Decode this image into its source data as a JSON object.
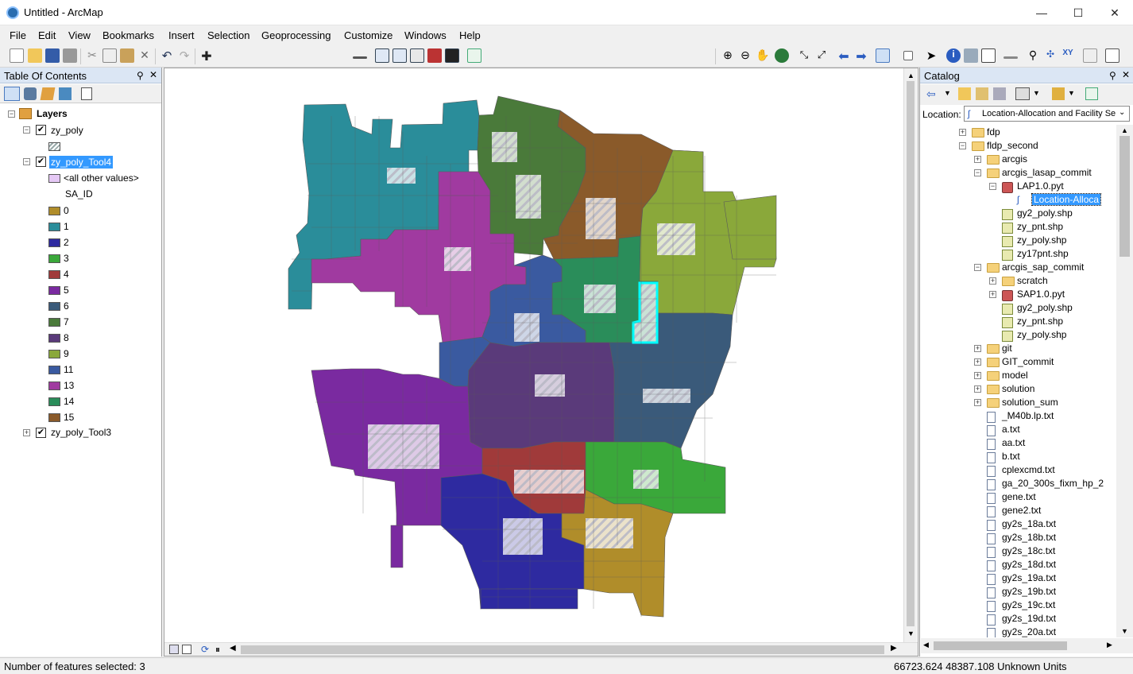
{
  "window": {
    "title": "Untitled - ArcMap",
    "min": "—",
    "max": "☐",
    "close": "✕"
  },
  "menu": [
    "File",
    "Edit",
    "View",
    "Bookmarks",
    "Insert",
    "Selection",
    "Geoprocessing",
    "Customize",
    "Windows",
    "Help"
  ],
  "toc": {
    "title": "Table Of Contents",
    "root": "Layers",
    "layer1": "zy_poly",
    "layer2": "zy_poly_Tool4",
    "other_values": "<all other values>",
    "field": "SA_ID",
    "classes": [
      {
        "label": "0",
        "color": "#b08d2a"
      },
      {
        "label": "1",
        "color": "#2a8d9a"
      },
      {
        "label": "2",
        "color": "#2e2aa0"
      },
      {
        "label": "3",
        "color": "#3aa83a"
      },
      {
        "label": "4",
        "color": "#a03a3a"
      },
      {
        "label": "5",
        "color": "#7a2aa0"
      },
      {
        "label": "6",
        "color": "#3a5a7a"
      },
      {
        "label": "7",
        "color": "#4a7a3a"
      },
      {
        "label": "8",
        "color": "#5a3a7a"
      },
      {
        "label": "9",
        "color": "#8aa83a"
      },
      {
        "label": "11",
        "color": "#3a5aa0"
      },
      {
        "label": "13",
        "color": "#a03aa0"
      },
      {
        "label": "14",
        "color": "#2a8d5a"
      },
      {
        "label": "15",
        "color": "#8a5a2a"
      }
    ],
    "layer3": "zy_poly_Tool3"
  },
  "catalog": {
    "title": "Catalog",
    "location_label": "Location:",
    "location_value": "Location-Allocation and Facility Ser",
    "items": [
      {
        "label": "fdp",
        "type": "folder",
        "indent": 0,
        "exp": "+"
      },
      {
        "label": "fldp_second",
        "type": "folder",
        "indent": 0,
        "exp": "−"
      },
      {
        "label": "arcgis",
        "type": "folder",
        "indent": 1,
        "exp": "+"
      },
      {
        "label": "arcgis_lasap_commit",
        "type": "folder",
        "indent": 1,
        "exp": "−"
      },
      {
        "label": "LAP1.0.pyt",
        "type": "pyt",
        "indent": 2,
        "exp": "−"
      },
      {
        "label": "Location-Alloca",
        "type": "script",
        "indent": 3,
        "exp": "",
        "selected": true
      },
      {
        "label": "gy2_poly.shp",
        "type": "shp",
        "indent": 2,
        "exp": ""
      },
      {
        "label": "zy_pnt.shp",
        "type": "shp",
        "indent": 2,
        "exp": ""
      },
      {
        "label": "zy_poly.shp",
        "type": "shp",
        "indent": 2,
        "exp": ""
      },
      {
        "label": "zy17pnt.shp",
        "type": "shp",
        "indent": 2,
        "exp": ""
      },
      {
        "label": "arcgis_sap_commit",
        "type": "folder",
        "indent": 1,
        "exp": "−"
      },
      {
        "label": "scratch",
        "type": "folder",
        "indent": 2,
        "exp": "+"
      },
      {
        "label": "SAP1.0.pyt",
        "type": "pyt",
        "indent": 2,
        "exp": "+"
      },
      {
        "label": "gy2_poly.shp",
        "type": "shp",
        "indent": 2,
        "exp": ""
      },
      {
        "label": "zy_pnt.shp",
        "type": "shp",
        "indent": 2,
        "exp": ""
      },
      {
        "label": "zy_poly.shp",
        "type": "shp",
        "indent": 2,
        "exp": ""
      },
      {
        "label": "git",
        "type": "folder",
        "indent": 1,
        "exp": "+"
      },
      {
        "label": "GIT_commit",
        "type": "folder",
        "indent": 1,
        "exp": "+"
      },
      {
        "label": "model",
        "type": "folder",
        "indent": 1,
        "exp": "+"
      },
      {
        "label": "solution",
        "type": "folder",
        "indent": 1,
        "exp": "+"
      },
      {
        "label": "solution_sum",
        "type": "folder",
        "indent": 1,
        "exp": "+"
      },
      {
        "label": "_M40b.lp.txt",
        "type": "doc",
        "indent": 1,
        "exp": ""
      },
      {
        "label": "a.txt",
        "type": "doc",
        "indent": 1,
        "exp": ""
      },
      {
        "label": "aa.txt",
        "type": "doc",
        "indent": 1,
        "exp": ""
      },
      {
        "label": "b.txt",
        "type": "doc",
        "indent": 1,
        "exp": ""
      },
      {
        "label": "cplexcmd.txt",
        "type": "doc",
        "indent": 1,
        "exp": ""
      },
      {
        "label": "ga_20_300s_fixm_hp_2",
        "type": "doc",
        "indent": 1,
        "exp": ""
      },
      {
        "label": "gene.txt",
        "type": "doc",
        "indent": 1,
        "exp": ""
      },
      {
        "label": "gene2.txt",
        "type": "doc",
        "indent": 1,
        "exp": ""
      },
      {
        "label": "gy2s_18a.txt",
        "type": "doc",
        "indent": 1,
        "exp": ""
      },
      {
        "label": "gy2s_18b.txt",
        "type": "doc",
        "indent": 1,
        "exp": ""
      },
      {
        "label": "gy2s_18c.txt",
        "type": "doc",
        "indent": 1,
        "exp": ""
      },
      {
        "label": "gy2s_18d.txt",
        "type": "doc",
        "indent": 1,
        "exp": ""
      },
      {
        "label": "gy2s_19a.txt",
        "type": "doc",
        "indent": 1,
        "exp": ""
      },
      {
        "label": "gy2s_19b.txt",
        "type": "doc",
        "indent": 1,
        "exp": ""
      },
      {
        "label": "gy2s_19c.txt",
        "type": "doc",
        "indent": 1,
        "exp": ""
      },
      {
        "label": "gy2s_19d.txt",
        "type": "doc",
        "indent": 1,
        "exp": ""
      },
      {
        "label": "gy2s_20a.txt",
        "type": "doc",
        "indent": 1,
        "exp": ""
      }
    ]
  },
  "status": {
    "selected": "Number of features selected: 3",
    "coords": "66723.624  48387.108 Unknown Units"
  }
}
